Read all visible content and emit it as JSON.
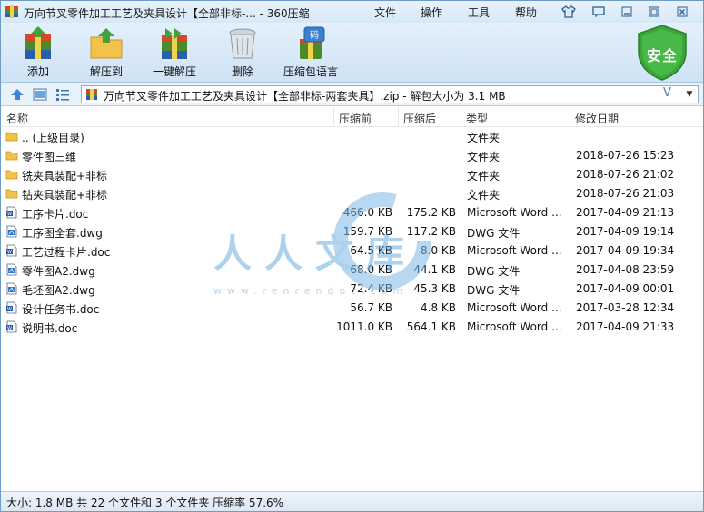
{
  "window": {
    "title": "万向节叉零件加工工艺及夹具设计【全部非标-... - 360压缩",
    "menu": [
      "文件",
      "操作",
      "工具",
      "帮助"
    ]
  },
  "toolbar": {
    "add_label": "添加",
    "extract_to_label": "解压到",
    "one_click_extract_label": "一键解压",
    "delete_label": "删除",
    "archive_language_label": "压缩包语言",
    "security_label": "安全"
  },
  "address": {
    "path": "万向节叉零件加工工艺及夹具设计【全部非标-两套夹具】.zip - 解包大小为 3.1 MB",
    "suffix_glyph": "V"
  },
  "columns": {
    "name": "名称",
    "compressed_before": "压缩前",
    "compressed_after": "压缩后",
    "type": "类型",
    "modified": "修改日期"
  },
  "files": [
    {
      "name": ".. (上级目录)",
      "size": "",
      "packed": "",
      "type": "文件夹",
      "date": "",
      "kind": "folder"
    },
    {
      "name": "零件图三维",
      "size": "",
      "packed": "",
      "type": "文件夹",
      "date": "2018-07-26 15:23",
      "kind": "folder"
    },
    {
      "name": "铣夹具装配+非标",
      "size": "",
      "packed": "",
      "type": "文件夹",
      "date": "2018-07-26 21:02",
      "kind": "folder"
    },
    {
      "name": "钻夹具装配+非标",
      "size": "",
      "packed": "",
      "type": "文件夹",
      "date": "2018-07-26 21:03",
      "kind": "folder"
    },
    {
      "name": "工序卡片.doc",
      "size": "466.0 KB",
      "packed": "175.2 KB",
      "type": "Microsoft Word ...",
      "date": "2017-04-09 21:13",
      "kind": "doc"
    },
    {
      "name": "工序图全套.dwg",
      "size": "159.7 KB",
      "packed": "117.2 KB",
      "type": "DWG 文件",
      "date": "2017-04-09 19:14",
      "kind": "dwg"
    },
    {
      "name": "工艺过程卡片.doc",
      "size": "64.5 KB",
      "packed": "8.0 KB",
      "type": "Microsoft Word ...",
      "date": "2017-04-09 19:34",
      "kind": "doc"
    },
    {
      "name": "零件图A2.dwg",
      "size": "68.0 KB",
      "packed": "44.1 KB",
      "type": "DWG 文件",
      "date": "2017-04-08 23:59",
      "kind": "dwg"
    },
    {
      "name": "毛坯图A2.dwg",
      "size": "72.4 KB",
      "packed": "45.3 KB",
      "type": "DWG 文件",
      "date": "2017-04-09 00:01",
      "kind": "dwg"
    },
    {
      "name": "设计任务书.doc",
      "size": "56.7 KB",
      "packed": "4.8 KB",
      "type": "Microsoft Word ...",
      "date": "2017-03-28 12:34",
      "kind": "doc"
    },
    {
      "name": "说明书.doc",
      "size": "1011.0 KB",
      "packed": "564.1 KB",
      "type": "Microsoft Word ...",
      "date": "2017-04-09 21:33",
      "kind": "doc"
    }
  ],
  "watermark": {
    "text": "人人文库",
    "url": "www.renrendoc.com"
  },
  "status": {
    "text": "大小: 1.8 MB 共 22 个文件和 3 个文件夹 压缩率 57.6%"
  },
  "colors": {
    "accent": "#2d5f91",
    "shield": "#3aa63a",
    "folder": "#f2c24a"
  }
}
